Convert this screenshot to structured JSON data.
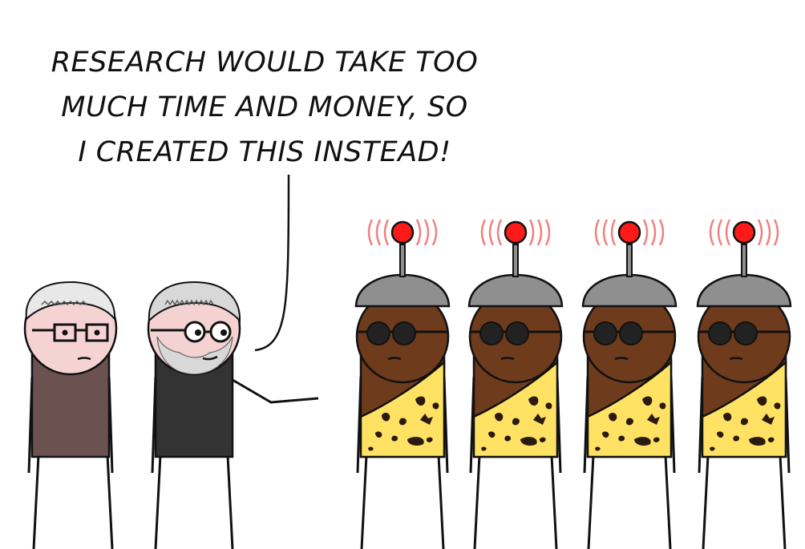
{
  "speech_bubble": {
    "lines": [
      "RESEARCH WOULD TAKE TOO",
      "MUCH TIME AND MONEY, SO",
      "I CREATED THIS INSTEAD!"
    ]
  },
  "characters": {
    "listener": {
      "shirt_color": "#6b5251",
      "skin_color": "#f6d3d3",
      "hair_color": "#e8e8e8"
    },
    "scientist": {
      "shirt_color": "#333333",
      "skin_color": "#f4d2d2",
      "hair_color": "#d8d8d8"
    },
    "robot_clone": {
      "count": 4,
      "skin_color": "#6e3b1c",
      "helmet_color": "#8f8f8f",
      "antenna_light_color": "#ff1a1a",
      "signal_color": "#f08080",
      "tunic_color": "#ffe263",
      "spot_color": "#2b1a0f",
      "sunglasses_color": "#222222"
    }
  },
  "icons": [
    "antenna-signal-icon",
    "glasses-icon",
    "sunglasses-icon"
  ]
}
